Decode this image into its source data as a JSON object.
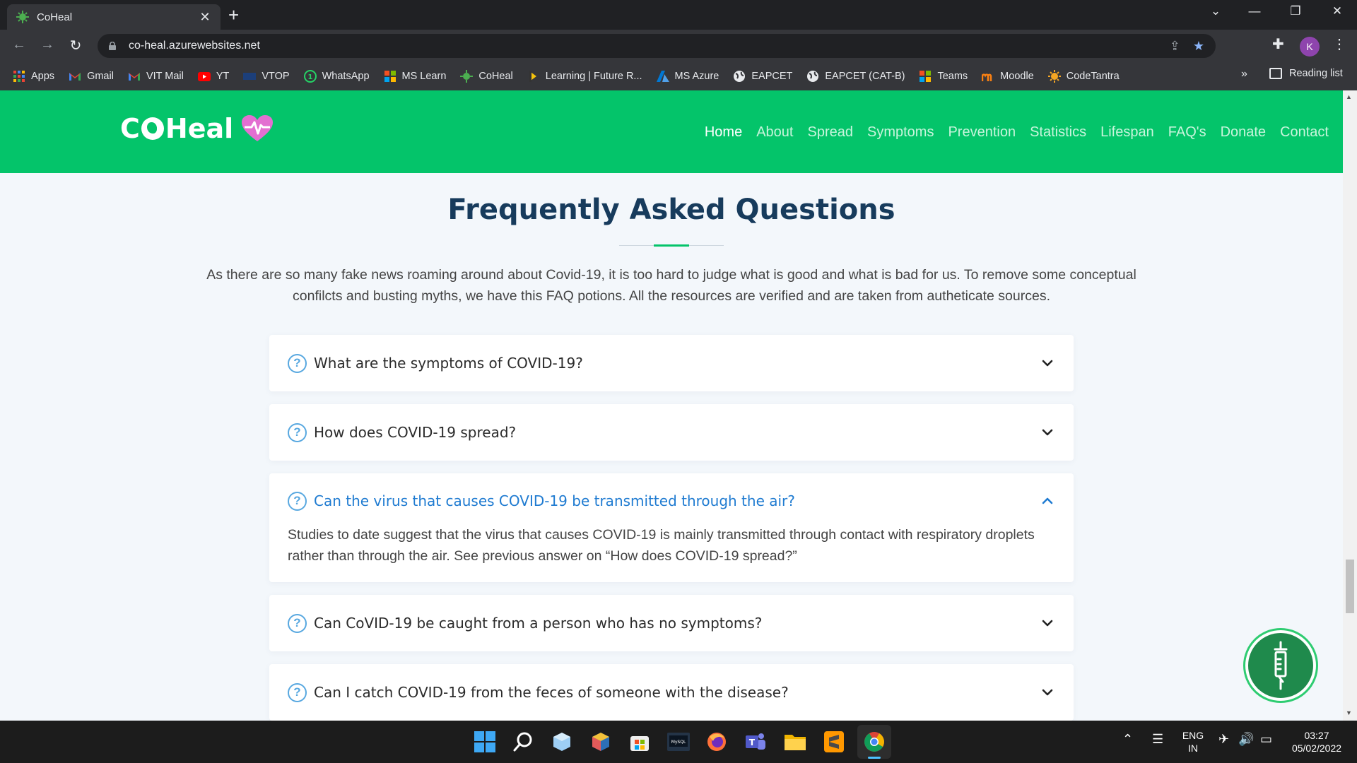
{
  "browser": {
    "tab_title": "CoHeal",
    "url": "co-heal.azurewebsites.net",
    "profile_initial": "K",
    "bookmarks": [
      {
        "label": "Apps",
        "icon": "apps-grid-icon"
      },
      {
        "label": "Gmail",
        "icon": "gmail-icon"
      },
      {
        "label": "VIT Mail",
        "icon": "gmail-icon"
      },
      {
        "label": "YT",
        "icon": "youtube-icon"
      },
      {
        "label": "VTOP",
        "icon": "vtop-icon"
      },
      {
        "label": "WhatsApp",
        "icon": "whatsapp-icon"
      },
      {
        "label": "MS Learn",
        "icon": "microsoft-icon"
      },
      {
        "label": "CoHeal",
        "icon": "virus-icon"
      },
      {
        "label": "Learning | Future R...",
        "icon": "futurelearn-icon"
      },
      {
        "label": "MS Azure",
        "icon": "azure-icon"
      },
      {
        "label": "EAPCET",
        "icon": "globe-icon"
      },
      {
        "label": "EAPCET (CAT-B)",
        "icon": "globe-icon"
      },
      {
        "label": "Teams",
        "icon": "microsoft-icon"
      },
      {
        "label": "Moodle",
        "icon": "moodle-icon"
      },
      {
        "label": "CodeTantra",
        "icon": "codetantra-icon"
      }
    ],
    "bookmarks_overflow": "»",
    "reading_list": "Reading list"
  },
  "site": {
    "logo_text_left": "C",
    "logo_text_right": "Heal",
    "nav": [
      "Home",
      "About",
      "Spread",
      "Symptoms",
      "Prevention",
      "Statistics",
      "Lifespan",
      "FAQ's",
      "Donate",
      "Contact"
    ],
    "active_nav": "Home",
    "brand_color": "#04c46a"
  },
  "faq": {
    "title": "Frequently Asked Questions",
    "intro": "As there are so many fake news roaming around about Covid-19, it is too hard to judge what is good and what is bad for us. To remove some conceptual confilcts and busting myths, we have this FAQ potions. All the resources are verified and are taken from autheticate sources.",
    "items": [
      {
        "question": "What are the symptoms of COVID-19?",
        "open": false
      },
      {
        "question": "How does COVID-19 spread?",
        "open": false
      },
      {
        "question": "Can the virus that causes COVID-19 be transmitted through the air?",
        "open": true,
        "answer": "Studies to date suggest that the virus that causes COVID-19 is mainly transmitted through contact with respiratory droplets rather than through the air. See previous answer on “How does COVID-19 spread?”"
      },
      {
        "question": "Can CoVID-19 be caught from a person who has no symptoms?",
        "open": false
      },
      {
        "question": "Can I catch COVID-19 from the feces of someone with the disease?",
        "open": false
      }
    ]
  },
  "taskbar": {
    "language_line1": "ENG",
    "language_line2": "IN",
    "time": "03:27",
    "date": "05/02/2022"
  }
}
